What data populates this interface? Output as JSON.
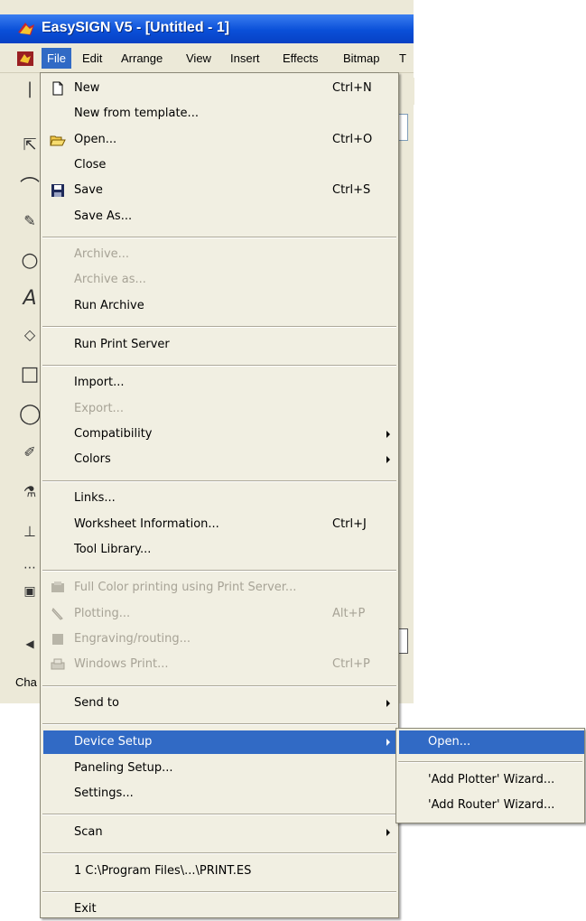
{
  "window": {
    "title": "EasySIGN V5 - [Untitled - 1]"
  },
  "menubar": {
    "items": [
      {
        "label": "File",
        "active": true
      },
      {
        "label": "Edit"
      },
      {
        "label": "Arrange"
      },
      {
        "label": "View"
      },
      {
        "label": "Insert"
      },
      {
        "label": "Effects"
      },
      {
        "label": "Bitmap"
      },
      {
        "label": "T"
      }
    ]
  },
  "status": {
    "text": "Cha"
  },
  "file_menu": {
    "items": [
      {
        "label": "New",
        "accel": "N",
        "shortcut": "Ctrl+N",
        "icon": "new-document-icon"
      },
      {
        "label": "New from template..."
      },
      {
        "label": "Open...",
        "accel": "O",
        "shortcut": "Ctrl+O",
        "icon": "open-folder-icon"
      },
      {
        "label": "Close",
        "accel": "C"
      },
      {
        "label": "Save",
        "accel": "S",
        "shortcut": "Ctrl+S",
        "icon": "save-disk-icon"
      },
      {
        "label": "Save As...",
        "accel": "A"
      },
      {
        "label": "Archive...",
        "disabled": true
      },
      {
        "label": "Archive as...",
        "disabled": true
      },
      {
        "label": "Run Archive"
      },
      {
        "label": "Run Print Server"
      },
      {
        "label": "Import...",
        "accel": "I"
      },
      {
        "label": "Export...",
        "disabled": true
      },
      {
        "label": "Compatibility",
        "submenu": true
      },
      {
        "label": "Colors",
        "submenu": true
      },
      {
        "label": "Links..."
      },
      {
        "label": "Worksheet Information...",
        "shortcut": "Ctrl+J"
      },
      {
        "label": "Tool Library..."
      },
      {
        "label": "Full Color printing using Print Server...",
        "disabled": true,
        "icon": "full-color-print-icon"
      },
      {
        "label": "Plotting...",
        "disabled": true,
        "shortcut": "Alt+P",
        "icon": "plotter-knife-icon"
      },
      {
        "label": "Engraving/routing...",
        "disabled": true,
        "icon": "engraving-icon"
      },
      {
        "label": "Windows Print...",
        "disabled": true,
        "shortcut": "Ctrl+P",
        "icon": "printer-icon"
      },
      {
        "label": "Send to",
        "submenu": true
      },
      {
        "label": "Device Setup",
        "submenu": true,
        "highlight": true
      },
      {
        "label": "Paneling Setup..."
      },
      {
        "label": "Settings..."
      },
      {
        "label": "Scan",
        "submenu": true
      },
      {
        "label": "1 C:\\Program Files\\...\\PRINT.ES"
      },
      {
        "label": "Exit"
      }
    ]
  },
  "device_setup_submenu": {
    "items": [
      {
        "label": "Open...",
        "highlight": true
      },
      {
        "label": "'Add Plotter' Wizard..."
      },
      {
        "label": "'Add Router' Wizard..."
      }
    ]
  },
  "colors": {
    "highlight": "#316ac5",
    "menu_bg": "#f1efe2",
    "titlebar": "#0a4fd8",
    "disabled_text": "#a7a396"
  }
}
